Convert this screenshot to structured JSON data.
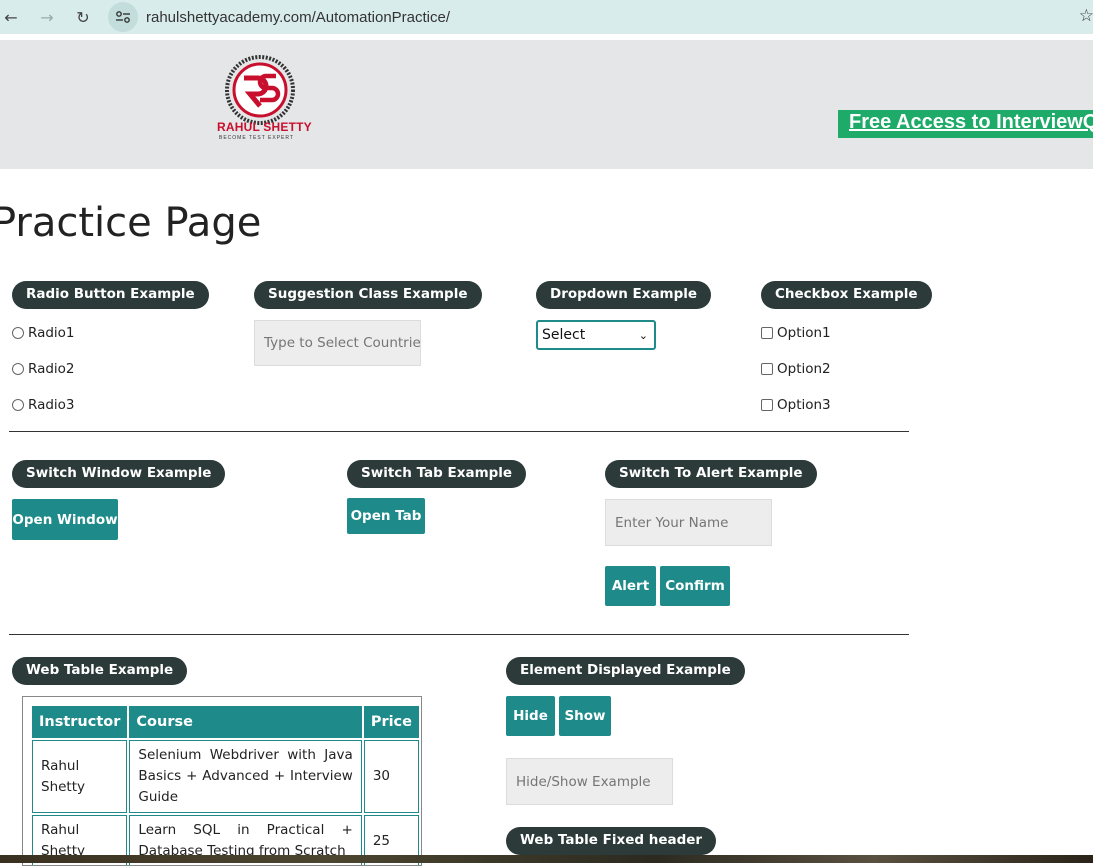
{
  "browser": {
    "url": "rahulshettyacademy.com/AutomationPractice/"
  },
  "header": {
    "logo_text": "RAHUL SHETTY",
    "logo_tagline": "BECOME TEST EXPERT",
    "promo": "Free Access to InterviewQ"
  },
  "page_title": "Practice Page",
  "radio_section": {
    "legend": "Radio Button Example",
    "options": [
      "Radio1",
      "Radio2",
      "Radio3"
    ]
  },
  "suggestion_section": {
    "legend": "Suggestion Class Example",
    "placeholder": "Type to Select Countries"
  },
  "dropdown_section": {
    "legend": "Dropdown Example",
    "selected": "Select"
  },
  "checkbox_section": {
    "legend": "Checkbox Example",
    "options": [
      "Option1",
      "Option2",
      "Option3"
    ]
  },
  "switch_window": {
    "legend": "Switch Window Example",
    "button": "Open Window"
  },
  "switch_tab": {
    "legend": "Switch Tab Example",
    "button": "Open Tab"
  },
  "alert_section": {
    "legend": "Switch To Alert Example",
    "placeholder": "Enter Your Name",
    "alert_button": "Alert",
    "confirm_button": "Confirm"
  },
  "web_table": {
    "legend": "Web Table Example",
    "headers": [
      "Instructor",
      "Course",
      "Price"
    ],
    "rows": [
      [
        "Rahul Shetty",
        "Selenium Webdriver with Java Basics + Advanced + Interview Guide",
        "30"
      ],
      [
        "Rahul Shetty",
        "Learn SQL in Practical + Database Testing from Scratch",
        "25"
      ]
    ]
  },
  "element_displayed": {
    "legend": "Element Displayed Example",
    "hide_button": "Hide",
    "show_button": "Show",
    "placeholder": "Hide/Show Example"
  },
  "fixed_header": {
    "legend": "Web Table Fixed header"
  }
}
